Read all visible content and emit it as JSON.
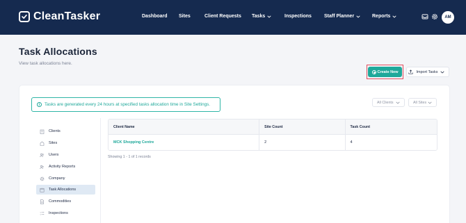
{
  "brand": {
    "name": "CleanTasker"
  },
  "nav": {
    "items": [
      {
        "label": "Dashboard",
        "dropdown": false
      },
      {
        "label": "Sites",
        "dropdown": false
      },
      {
        "label": "Client Requests",
        "dropdown": false
      },
      {
        "label": "Tasks",
        "dropdown": true
      },
      {
        "label": "Inspections",
        "dropdown": false
      },
      {
        "label": "Staff Planner",
        "dropdown": true
      },
      {
        "label": "Reports",
        "dropdown": true
      }
    ],
    "icons": [
      "inbox-icon",
      "gear-icon"
    ],
    "avatar_initials": "AM"
  },
  "page": {
    "title": "Task Allocations",
    "subtitle": "View task allocations here."
  },
  "actions": {
    "create_label": "Create New",
    "import_label": "Import Tasks"
  },
  "info": {
    "message": "Tasks are generated every 24 hours at specified tasks allocation time in Site Settings."
  },
  "filters": {
    "clients": "All Clients",
    "sites": "All Sites"
  },
  "sidebar": {
    "items": [
      {
        "label": "Clients",
        "icon": "building-icon",
        "active": false
      },
      {
        "label": "Sites",
        "icon": "site-icon",
        "active": false
      },
      {
        "label": "Users",
        "icon": "users-icon",
        "active": false
      },
      {
        "label": "Activity Reports",
        "icon": "activity-icon",
        "active": false
      },
      {
        "label": "Company",
        "icon": "gear-icon",
        "active": false
      },
      {
        "label": "Task Allocations",
        "icon": "calendar-icon",
        "active": true
      },
      {
        "label": "Commodities",
        "icon": "document-icon",
        "active": false
      },
      {
        "label": "Inspections",
        "icon": "checklist-icon",
        "active": false
      }
    ]
  },
  "table": {
    "headers": [
      "Client Name",
      "Site Count",
      "Task Count"
    ],
    "rows": [
      {
        "client": "MCK Shopping Centre",
        "site_count": "2",
        "task_count": "4"
      }
    ],
    "footer": "Showing 1 - 1 of 1 records"
  },
  "colors": {
    "navbar": "#152a4f",
    "accent": "#1fa89a",
    "highlight_outline": "#e04a5c",
    "active_sidebar": "#dfe9f4"
  }
}
